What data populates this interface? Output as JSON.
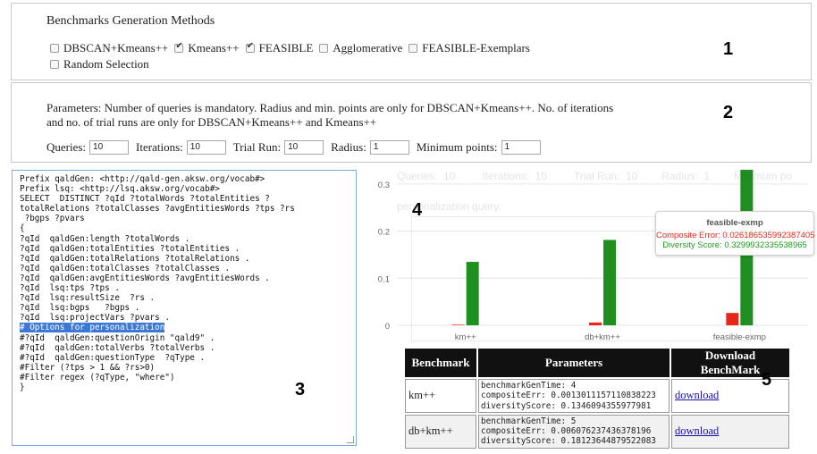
{
  "methods": {
    "heading": "Benchmarks Generation Methods",
    "options": [
      {
        "label": "DBSCAN+Kmeans++",
        "checked": false
      },
      {
        "label": "Kmeans++",
        "checked": true
      },
      {
        "label": "FEASIBLE",
        "checked": true
      },
      {
        "label": "Agglomerative",
        "checked": false
      },
      {
        "label": "FEASIBLE-Exemplars",
        "checked": false
      },
      {
        "label": "Random Selection",
        "checked": false
      }
    ]
  },
  "parameters": {
    "description": "Parameters: Number of queries is mandatory. Radius and min. points are only for DBSCAN+Kmeans++. No. of iterations and no. of trial runs are only for DBSCAN+Kmeans++ and Kmeans++",
    "queries_label": "Queries:",
    "queries_value": "10",
    "iterations_label": "Iterations:",
    "iterations_value": "10",
    "trial_label": "Trial Run:",
    "trial_value": "10",
    "radius_label": "Radius:",
    "radius_value": "1",
    "minpoints_label": "Minimum points:",
    "minpoints_value": "1"
  },
  "query": {
    "lines_before": "Prefix qaldGen: <http://qald-gen.aksw.org/vocab#>\nPrefix lsq: <http://lsq.aksw.org/vocab#>\nSELECT  DISTINCT ?qId ?totalWords ?totalEntities ?\ntotalRelations ?totalClasses ?avgEntitiesWords ?tps ?rs\n ?bgps ?pvars\n{\n?qId  qaldGen:length ?totalWords .\n?qId  qaldGen:totalEntities ?totalEntities .\n?qId  qaldGen:totalRelations ?totalRelations .\n?qId  qaldGen:totalClasses ?totalClasses .\n?qId  qaldGen:avgEntitiesWords ?avgEntitiesWords .\n?qId  lsq:tps ?tps .\n?qId  lsq:resultSize  ?rs .\n?qId  lsq:bgps   ?bgps .\n?qId  lsq:projectVars ?pvars .\n",
    "highlighted": "# Options for personalization",
    "lines_after": "\n#?qId  qaldGen:questionOrigin \"qald9\" .\n#?qId  qaldGen:totalVerbs ?totalVerbs .\n#?qId  qaldGen:questionType  ?qType .\n#Filter (?tps > 1 && ?rs>0)\n#Filter regex (?qType, \"where\")\n}"
  },
  "callouts": {
    "n1": "1",
    "n2": "2",
    "n3": "3",
    "n4": "4",
    "n5": "5"
  },
  "chart_data": {
    "type": "bar",
    "categories": [
      "km++",
      "db+km++",
      "feasible-exmp"
    ],
    "series": [
      {
        "name": "Composite Error",
        "color": "#e8261a",
        "values": [
          0.0013,
          0.006,
          0.0262
        ]
      },
      {
        "name": "Diversity Score",
        "color": "#1f8f1f",
        "values": [
          0.1346,
          0.1812,
          0.33
        ]
      }
    ],
    "yticks": [
      "0",
      "0.1",
      "0.2",
      "0.3"
    ],
    "ylim": [
      0,
      0.33
    ],
    "grid": true
  },
  "tooltip": {
    "title": "feasible-exmp",
    "err_text": "Composite Error: 0.026186535992387405",
    "div_text": "Diversity Score: 0.3299932335538965"
  },
  "ghost": {
    "fields": "Queries:  10         Iterations:  10         Trial Run:  10        Radius:  1        Minimum po",
    "label": "personalization query:"
  },
  "table": {
    "headers": [
      "Benchmark",
      "Parameters",
      "Download BenchMark"
    ],
    "rows": [
      {
        "name": "km++",
        "params": "benchmarkGenTime: 4\ncompositeErr: 0.0013011157110838223\ndiversityScore: 0.1346094355977981",
        "link": "download"
      },
      {
        "name": "db+km++",
        "params": "benchmarkGenTime: 5\ncompositeErr: 0.006076237436378196\ndiversityScore: 0.18123644879522083",
        "link": "download"
      }
    ]
  }
}
